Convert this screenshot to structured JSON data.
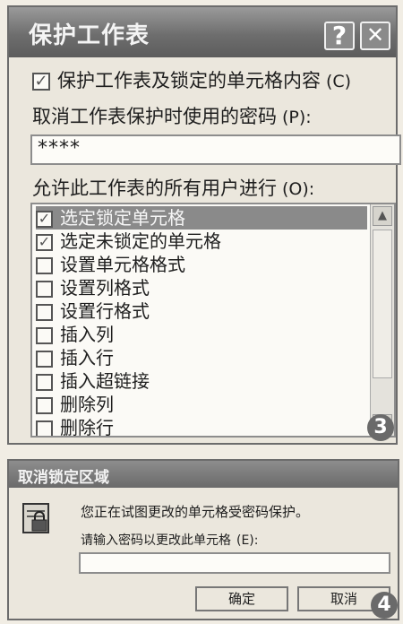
{
  "protect_dialog": {
    "title": "保护工作表",
    "help_button": "?",
    "close_button": "✕",
    "protect_checkbox_label": "保护工作表及锁定的单元格内容",
    "protect_checkbox_shortcut": "(C)",
    "protect_checked": true,
    "password_label": "取消工作表保护时使用的密码",
    "password_shortcut": "(P):",
    "password_value": "****",
    "allow_label": "允许此工作表的所有用户进行",
    "allow_shortcut": "(O):",
    "permissions": [
      {
        "label": "选定锁定单元格",
        "checked": true,
        "selected": true
      },
      {
        "label": "选定未锁定的单元格",
        "checked": true,
        "selected": false
      },
      {
        "label": "设置单元格格式",
        "checked": false,
        "selected": false
      },
      {
        "label": "设置列格式",
        "checked": false,
        "selected": false
      },
      {
        "label": "设置行格式",
        "checked": false,
        "selected": false
      },
      {
        "label": "插入列",
        "checked": false,
        "selected": false
      },
      {
        "label": "插入行",
        "checked": false,
        "selected": false
      },
      {
        "label": "插入超链接",
        "checked": false,
        "selected": false
      },
      {
        "label": "删除列",
        "checked": false,
        "selected": false
      },
      {
        "label": "删除行",
        "checked": false,
        "selected": false
      }
    ],
    "step_badge": "3"
  },
  "unlock_dialog": {
    "title": "取消锁定区域",
    "message": "您正在试图更改的单元格受密码保护。",
    "prompt_label": "请输入密码以更改此单元格",
    "prompt_shortcut": "(E):",
    "password_value": "",
    "ok_label": "确定",
    "cancel_label": "取消",
    "step_badge": "4"
  },
  "colors": {
    "titlebar": "#6e6e6e",
    "selection": "#8a8a8a",
    "dialog_bg": "#ebe7dd"
  }
}
